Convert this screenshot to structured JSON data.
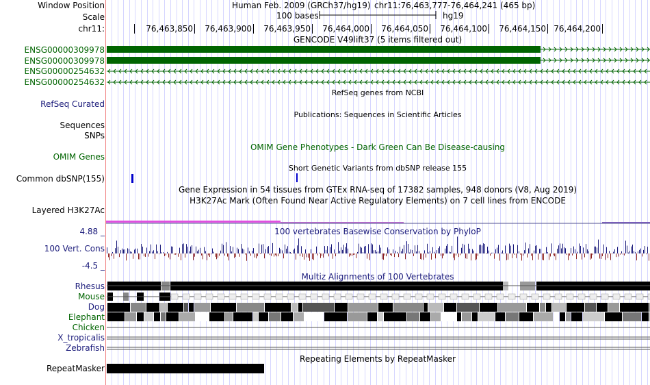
{
  "header": {
    "labels": {
      "window": "Window Position",
      "scale": "Scale",
      "chrom": "chr11:"
    },
    "assembly": "Human Feb. 2009 (GRCh37/hg19)",
    "position": "chr11:76,463,777-76,464,241 (465 bp)",
    "scale_text": "100 bases",
    "scale_db": "hg19",
    "ticks": [
      "76,463,850",
      "76,463,900",
      "76,463,950",
      "76,464,000",
      "76,464,050",
      "76,464,100",
      "76,464,150",
      "76,464,200"
    ]
  },
  "tracks": {
    "gencode": {
      "title": "GENCODE V49lift37 (5 items filtered out)",
      "items": [
        "ENSG00000309978",
        "ENSG00000309978",
        "ENSG00000254632",
        "ENSG00000254632"
      ],
      "color": "#006400"
    },
    "refseq": {
      "title": "RefSeq genes from NCBI",
      "label": "RefSeq Curated",
      "color": "#1a1a7a"
    },
    "pubs": {
      "title": "Publications: Sequences in Scientific Articles",
      "label1": "Sequences",
      "label2": "SNPs"
    },
    "omim": {
      "title": "OMIM Gene Phenotypes - Dark Green Can Be Disease-causing",
      "label": "OMIM Genes",
      "color": "#006400"
    },
    "dbsnp": {
      "title": "Short Genetic Variants from dbSNP release 155",
      "label": "Common dbSNP(155)",
      "color": "#0000cc"
    },
    "gtex": {
      "title": "Gene Expression in 54 tissues from GTEx RNA-seq of 17382 samples, 948 donors (V8, Aug 2019)"
    },
    "h3k27ac": {
      "title": "H3K27Ac Mark (Often Found Near Active Regulatory Elements) on 7 cell lines from ENCODE",
      "label": "Layered H3K27Ac"
    },
    "phylop": {
      "title": "100 vertebrates Basewise Conservation by PhyloP",
      "label": "100 Vert. Cons",
      "max": "4.88 _",
      "min": "-4.5 _",
      "color": "#1a1a7a"
    },
    "multiz": {
      "title": "Multiz Alignments of 100 Vertebrates",
      "species": [
        "Rhesus",
        "Mouse",
        "Dog",
        "Elephant",
        "Chicken",
        "X_tropicalis",
        "Zebrafish"
      ],
      "colors": {
        "rhesus": "#1a1a7a",
        "other": "#006400"
      }
    },
    "rmsk": {
      "title": "Repeating Elements by RepeatMasker",
      "label": "RepeatMasker"
    }
  }
}
